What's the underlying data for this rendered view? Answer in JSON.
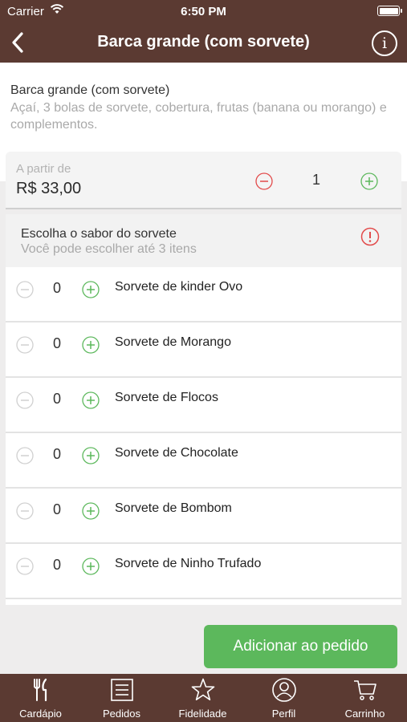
{
  "status_bar": {
    "carrier": "Carrier",
    "time": "6:50 PM"
  },
  "nav": {
    "title": "Barca grande (com sorvete)",
    "info_label": "i"
  },
  "product": {
    "name": "Barca grande (com sorvete)",
    "description": "Açaí, 3 bolas de sorvete, cobertura, frutas (banana ou morango) e complementos."
  },
  "price_box": {
    "from_label": "A partir de",
    "price": "R$ 33,00",
    "quantity": "1"
  },
  "section": {
    "title": "Escolha o sabor do sorvete",
    "subtitle": "Você pode escolher até 3 itens"
  },
  "options": [
    {
      "count": "0",
      "name": "Sorvete de kinder Ovo"
    },
    {
      "count": "0",
      "name": "Sorvete de Morango"
    },
    {
      "count": "0",
      "name": "Sorvete de Flocos"
    },
    {
      "count": "0",
      "name": "Sorvete de Chocolate"
    },
    {
      "count": "0",
      "name": "Sorvete de Bombom"
    },
    {
      "count": "0",
      "name": "Sorvete de Ninho Trufado"
    }
  ],
  "add_button": {
    "label": "Adicionar ao pedido"
  },
  "tabs": [
    {
      "label": "Cardápio",
      "icon": "fork-knife-icon"
    },
    {
      "label": "Pedidos",
      "icon": "list-icon"
    },
    {
      "label": "Fidelidade",
      "icon": "star-icon"
    },
    {
      "label": "Perfil",
      "icon": "user-icon"
    },
    {
      "label": "Carrinho",
      "icon": "cart-icon"
    }
  ],
  "colors": {
    "brand": "#5b3a32",
    "accent_green": "#5cb85c",
    "danger_red": "#e24a4a",
    "disabled_gray": "#d0d0d0"
  }
}
